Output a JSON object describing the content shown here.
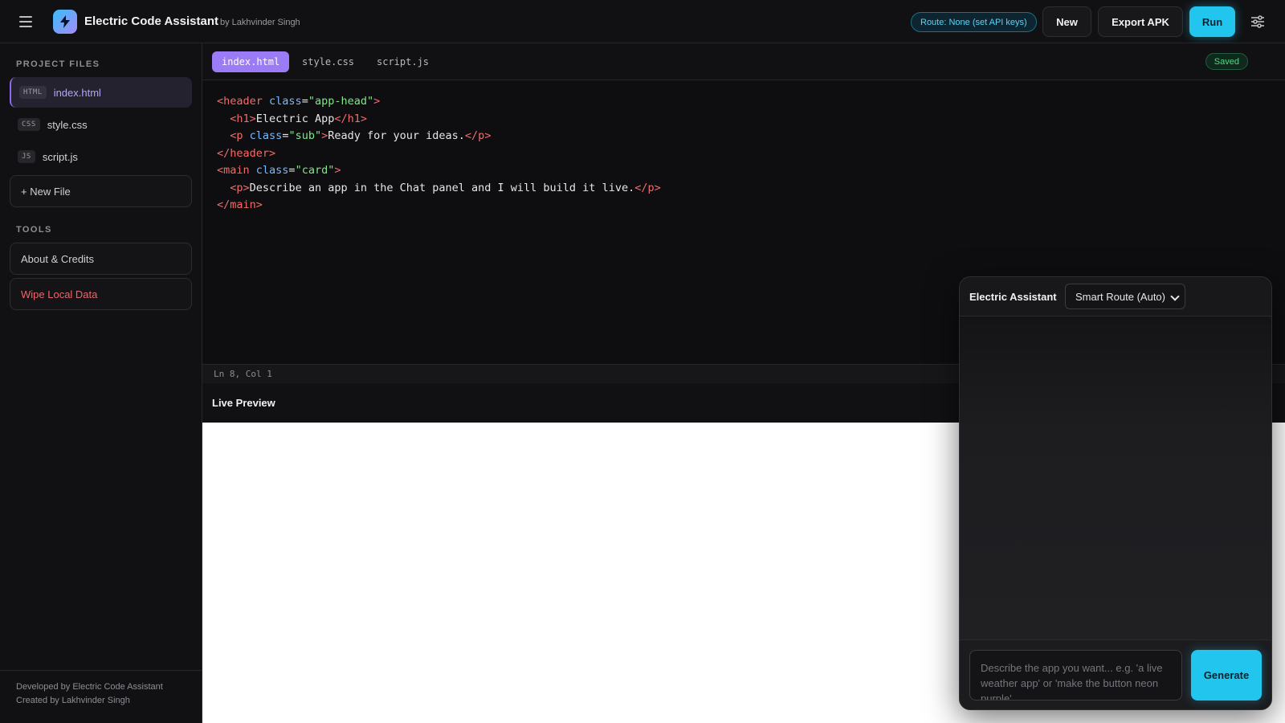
{
  "header": {
    "title": "Electric Code Assistant",
    "byline": "by Lakhvinder Singh",
    "route_status": "Route: None (set API keys)",
    "new_label": "New",
    "export_label": "Export APK",
    "run_label": "Run",
    "icons": [
      "menu-icon",
      "bolt-icon",
      "settings-sliders-icon"
    ]
  },
  "sidebar": {
    "files_heading": "PROJECT FILES",
    "files": [
      {
        "tag": "HTML",
        "name": "index.html",
        "active": true
      },
      {
        "tag": "CSS",
        "name": "style.css",
        "active": false
      },
      {
        "tag": "JS",
        "name": "script.js",
        "active": false
      }
    ],
    "new_file_label": "+ New File",
    "tools_heading": "TOOLS",
    "tools": [
      "About & Credits",
      "Wipe Local Data"
    ],
    "footer": [
      "Developed by Electric Code Assistant",
      "Created by Lakhvinder Singh"
    ]
  },
  "editor": {
    "tabs": [
      "index.html",
      "style.css",
      "script.js"
    ],
    "active_tab": "index.html",
    "save_status": "Saved",
    "cursor_position": "Ln 8, Col 1",
    "code_lines": [
      "<header class=\"app-head\">",
      "  <h1>Electric App</h1>",
      "  <p class=\"sub\">Ready for your ideas.</p>",
      "</header>",
      "<main class=\"card\">",
      "  <p>Describe an app in the Chat panel and I will build it live.</p>",
      "</main>"
    ]
  },
  "preview": {
    "title": "Live Preview"
  },
  "chat": {
    "title": "Electric Assistant",
    "route_selected": "Smart Route (Auto)",
    "input_placeholder": "Describe the app you want... e.g. 'a live weather app' or 'make the button neon purple'",
    "generate_label": "Generate"
  },
  "colors": {
    "accent_cyan": "#22c5ee",
    "accent_purple": "#9b7cf6",
    "danger": "#f0646c",
    "success": "#4ade80"
  }
}
